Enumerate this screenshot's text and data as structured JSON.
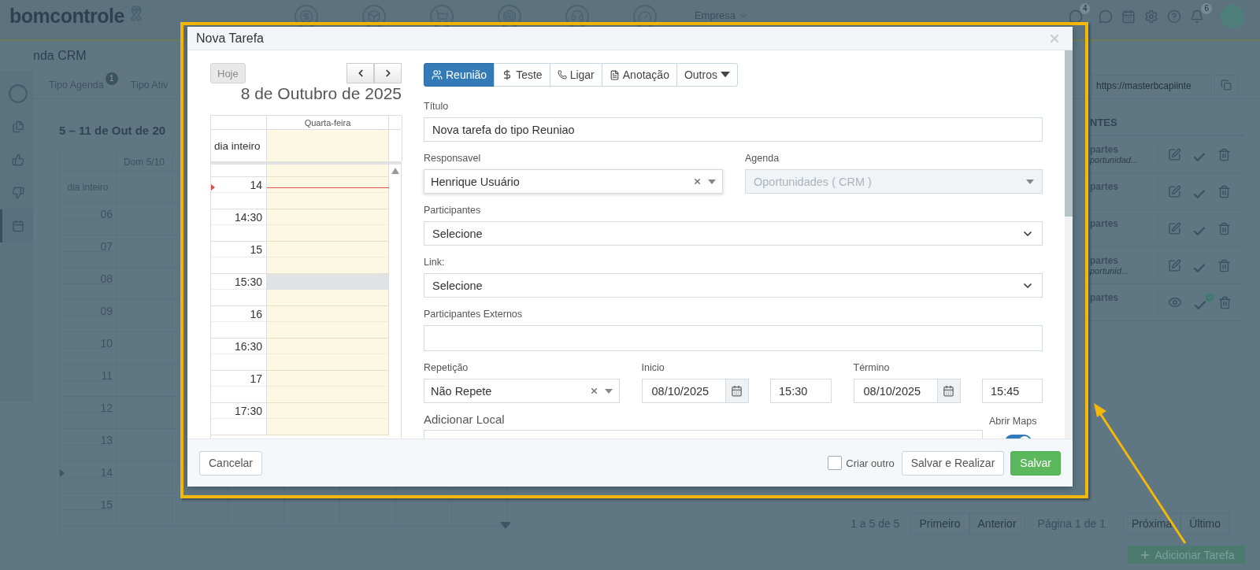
{
  "app_header": {
    "logo": "bomcontrole",
    "company_menu": "Empresa",
    "message_badge": "4",
    "notification_badge": "6",
    "nav": [
      {
        "kind": "dollar"
      },
      {
        "kind": "box"
      },
      {
        "kind": "cart"
      },
      {
        "kind": "target"
      },
      {
        "kind": "headset"
      },
      {
        "kind": "gauge"
      }
    ]
  },
  "page_title": "nda CRM",
  "sidebar": {
    "items": [
      {
        "kind": "documents",
        "selected": false
      },
      {
        "kind": "like",
        "selected": false
      },
      {
        "kind": "dislike",
        "selected": false
      },
      {
        "kind": "calendar",
        "selected": true
      }
    ]
  },
  "toolbar": {
    "filters": [
      {
        "label": "Tipo Agenda",
        "badge": "1"
      },
      {
        "label": "Tipo Ativ"
      }
    ],
    "url_field": "https://masterbcapiinte"
  },
  "week_calendar": {
    "title": "5 – 11 de Out de 20",
    "columns": [
      "Dom 5/10"
    ],
    "all_day_label": "dia inteiro",
    "hours": [
      "06",
      "07",
      "08",
      "09",
      "10",
      "11",
      "12",
      "13",
      "14",
      "15"
    ]
  },
  "tasks_table": {
    "header": "NTES",
    "rows": [
      {
        "participants": "partes",
        "subtitle": "portunidad...",
        "kind": "edit",
        "done": false
      },
      {
        "participants": "partes",
        "kind": "edit",
        "done": false
      },
      {
        "participants": "partes",
        "kind": "edit",
        "done": false
      },
      {
        "participants": "partes",
        "subtitle": "portunid...",
        "kind": "edit",
        "done": false
      },
      {
        "participants": "partes",
        "kind": "view",
        "done": true
      }
    ]
  },
  "pagination": {
    "summary": "1 a 5 de 5",
    "page_label": "Página 1 de 1",
    "buttons": [
      {
        "label": "Primeiro",
        "disabled": true
      },
      {
        "label": "Anterior",
        "disabled": true
      },
      {
        "label": "Próxima",
        "disabled": true
      },
      {
        "label": "Último",
        "disabled": true
      }
    ]
  },
  "add_task_button": "Adicionar Tarefa",
  "modal": {
    "title": "Nova Tarefa",
    "calendar": {
      "today_button": "Hoje",
      "heading": "8 de Outubro de 2025",
      "day_header": "Quarta-feira",
      "all_day_label": "dia inteiro",
      "slots": [
        {
          "label": "14",
          "current": true,
          "selected": false
        },
        {
          "label": "14:30",
          "current": false,
          "selected": false
        },
        {
          "label": "15",
          "current": false,
          "selected": false
        },
        {
          "label": "15:30",
          "current": false,
          "selected": true
        },
        {
          "label": "16",
          "current": false,
          "selected": false
        },
        {
          "label": "16:30",
          "current": false,
          "selected": false
        },
        {
          "label": "17",
          "current": false,
          "selected": false
        },
        {
          "label": "17:30",
          "current": false,
          "selected": false
        }
      ]
    },
    "tabs": [
      {
        "label": "Reunião",
        "kind": "meeting",
        "selected": true
      },
      {
        "label": "Teste",
        "kind": "money",
        "selected": false
      },
      {
        "label": "Ligar",
        "kind": "phone",
        "selected": false
      },
      {
        "label": "Anotação",
        "kind": "note",
        "selected": false
      },
      {
        "label": "Outros",
        "kind": "dropdown",
        "selected": false
      }
    ],
    "title_field": {
      "label": "Título",
      "value": "Nova tarefa do tipo Reuniao"
    },
    "responsible": {
      "label": "Responsavel",
      "value": "Henrique Usuário"
    },
    "agenda": {
      "label": "Agenda",
      "value": "Oportunidades ( CRM )",
      "disabled": true
    },
    "participants": {
      "label": "Participantes",
      "value": "Selecione"
    },
    "link": {
      "label": "Link:",
      "value": "Selecione"
    },
    "external_participants": {
      "label": "Participantes Externos"
    },
    "repeat": {
      "label": "Repetição",
      "value": "Não Repete"
    },
    "start": {
      "label": "Inicio",
      "date": "08/10/2025",
      "time": "15:30"
    },
    "end": {
      "label": "Término",
      "date": "08/10/2025",
      "time": "15:45"
    },
    "location": {
      "label": "Adicionar Local"
    },
    "open_maps": {
      "label": "Abrir Maps",
      "on": true
    },
    "footer": {
      "cancel": "Cancelar",
      "create_another": {
        "label": "Criar outro",
        "checked": false
      },
      "save_and_complete": "Salvar e Realizar",
      "save": "Salvar"
    }
  }
}
